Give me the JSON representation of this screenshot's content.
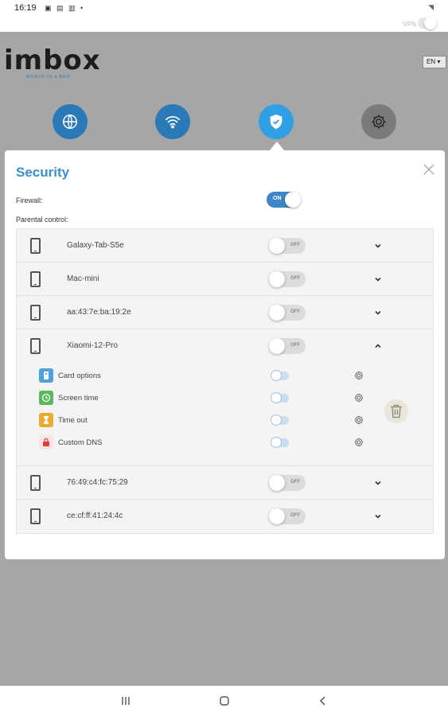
{
  "status_bar": {
    "time": "16:19",
    "notification_icons": "▣ ▤ ▥ •",
    "vpn_label": "VPN"
  },
  "header": {
    "logo_text": "imbox",
    "logo_tagline": "WORLD IN A BOX",
    "language": "EN ▾"
  },
  "nav": [
    {
      "name": "web",
      "icon": "globe-icon",
      "color": "#2a7ab8",
      "active": false
    },
    {
      "name": "wifi",
      "icon": "wifi-icon",
      "color": "#2a7ab8",
      "active": false
    },
    {
      "name": "security",
      "icon": "shield-icon",
      "color": "#2f9fe6",
      "active": true
    },
    {
      "name": "settings",
      "icon": "gear-icon",
      "color": "#7a7a7a",
      "active": false
    }
  ],
  "panel": {
    "title": "Security",
    "firewall_label": "Firewall:",
    "firewall_state": "ON",
    "parental_label": "Parental control:",
    "devices": [
      {
        "name": "Galaxy-Tab-S5e",
        "state": "OFF",
        "expanded": false
      },
      {
        "name": "Mac-mini",
        "state": "OFF",
        "expanded": false
      },
      {
        "name": "aa:43:7e:ba:19:2e",
        "state": "OFF",
        "expanded": false
      },
      {
        "name": "Xiaomi-12-Pro",
        "state": "OFF",
        "expanded": true
      },
      {
        "name": "76:49:c4:fc:75:29",
        "state": "OFF",
        "expanded": false
      },
      {
        "name": "ce:cf:ff:41:24:4c",
        "state": "OFF",
        "expanded": false
      }
    ],
    "options": [
      {
        "label": "Card options",
        "icon": "card-icon",
        "color": "#4aa3df"
      },
      {
        "label": "Screen time",
        "icon": "clock-icon",
        "color": "#5cb85c"
      },
      {
        "label": "Time out",
        "icon": "hourglass-icon",
        "color": "#f0a830"
      },
      {
        "label": "Custom DNS",
        "icon": "lock-icon",
        "color": "#e53935"
      }
    ]
  }
}
